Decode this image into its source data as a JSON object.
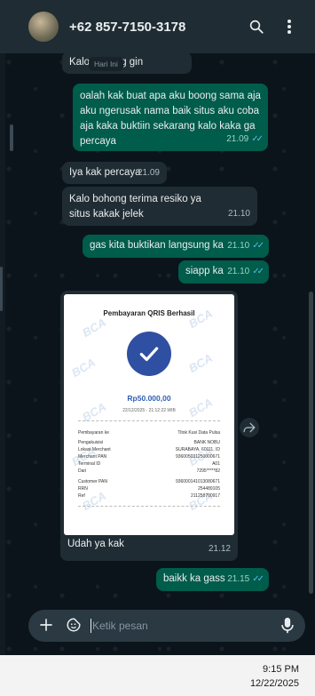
{
  "header": {
    "contact_name": "+62 857-7150-3178"
  },
  "date_divider": "Hari Ini",
  "messages": [
    {
      "dir": "in",
      "text": "Kalo bohong gin",
      "time": ""
    },
    {
      "dir": "out",
      "text": "oalah kak buat apa aku boong sama aja aku ngerusak nama baik situs aku coba aja kaka buktiin sekarang kalo kaka ga percaya",
      "time": "21.09"
    },
    {
      "dir": "in",
      "text": "Iya kak percaya",
      "time": "21.09"
    },
    {
      "dir": "in",
      "text": "Kalo bohong terima resiko ya situs kakak jelek",
      "time": "21.10"
    },
    {
      "dir": "out",
      "text": "gas kita buktikan langsung ka",
      "time": "21.10"
    },
    {
      "dir": "out",
      "text": "siapp ka",
      "time": "21.10"
    },
    {
      "dir": "in",
      "text": "Udah ya kak",
      "time": "21.12"
    },
    {
      "dir": "out",
      "text": "baikk ka gass",
      "time": "21.15"
    }
  ],
  "receipt": {
    "title": "Pembayaran QRIS Berhasil",
    "watermark": "BCA",
    "amount": "Rp50.000,00",
    "datetime": "22/12/2025 - 21:12:22 WIB",
    "rows": [
      {
        "label": "Pembayaran ke",
        "value": "Titok Kusi Data Pulsa"
      },
      {
        "label": "Pengakuisisi",
        "value": "BANK NOBU"
      },
      {
        "label": "Lokasi Merchant",
        "value": "SURABAYA, 60111, ID"
      },
      {
        "label": "Merchant PAN",
        "value": "936005031250000671"
      },
      {
        "label": "Terminal ID",
        "value": "A01"
      },
      {
        "label": "Dari",
        "value": "7295*****82"
      },
      {
        "label": "Customer PAN",
        "value": "936000141013080671"
      },
      {
        "label": "RRN",
        "value": "254489105"
      },
      {
        "label": "Ref",
        "value": "211258700917"
      }
    ]
  },
  "composer": {
    "placeholder": "Ketik pesan"
  },
  "taskbar": {
    "time": "9:15 PM",
    "date": "12/22/2025"
  }
}
